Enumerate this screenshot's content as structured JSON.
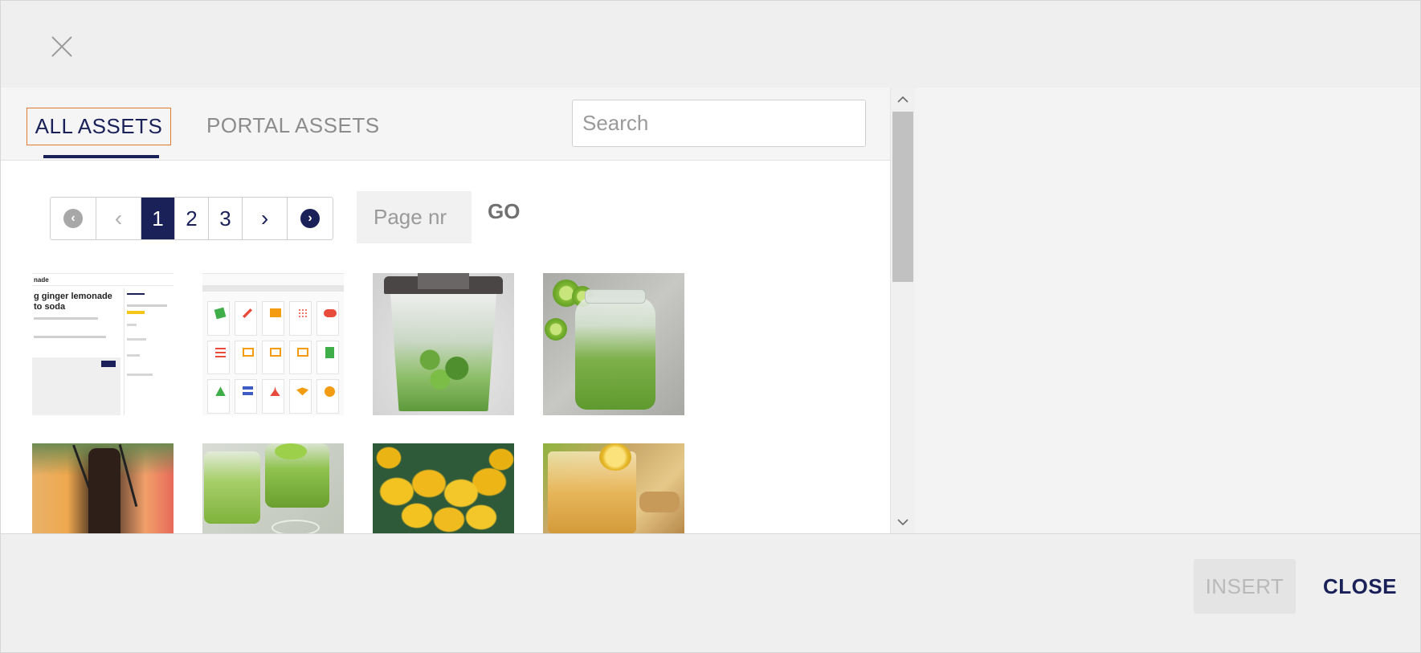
{
  "dialog": {
    "close_icon": "close-icon"
  },
  "tabs": [
    {
      "label": "ALL ASSETS",
      "active": true
    },
    {
      "label": "PORTAL ASSETS",
      "active": false
    }
  ],
  "search": {
    "placeholder": "Search",
    "value": ""
  },
  "pagination": {
    "pages": [
      "1",
      "2",
      "3"
    ],
    "current": "1",
    "prev_glyph": "‹",
    "next_glyph": "›",
    "first_glyph": "‹",
    "last_glyph": "›",
    "page_input_placeholder": "Page nr",
    "go_label": "GO"
  },
  "thumbnails": {
    "shot1": {
      "partial_title": "nade",
      "heading_line1": "g ginger lemonade",
      "heading_line2": "to soda"
    },
    "items": [
      {
        "kind": "screenshot-article"
      },
      {
        "kind": "screenshot-icons"
      },
      {
        "kind": "photo-blender-greens"
      },
      {
        "kind": "photo-green-juice-jar"
      },
      {
        "kind": "photo-cocktails"
      },
      {
        "kind": "photo-green-shots"
      },
      {
        "kind": "photo-lemon-tree"
      },
      {
        "kind": "photo-ginger-drink"
      }
    ]
  },
  "colors": {
    "brand_navy": "#1a2159",
    "active_tab_border": "#e07a2e"
  },
  "footer": {
    "insert_label": "INSERT",
    "insert_disabled": true,
    "close_label": "CLOSE"
  }
}
